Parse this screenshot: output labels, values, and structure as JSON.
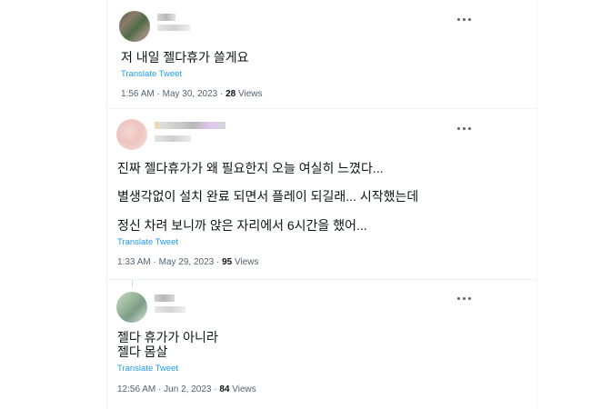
{
  "tweets": [
    {
      "text_lines": [
        "저 내일 젤다휴가 쓸게요"
      ],
      "translate_label": "Translate Tweet",
      "time": "1:56 AM",
      "date": "May 30, 2023",
      "views_count": "28",
      "views_label": "Views"
    },
    {
      "text_lines": [
        "진짜 젤다휴가가 왜 필요한지 오늘 여실히 느꼈다...",
        "별생각없이 설치 완료 되면서 플레이 되길래... 시작했는데",
        "정신 차려 보니까 앉은 자리에서 6시간을 했어..."
      ],
      "translate_label": "Translate Tweet",
      "time": "1:33 AM",
      "date": "May 29, 2023",
      "views_count": "95",
      "views_label": "Views"
    },
    {
      "text_lines": [
        "젤다 휴가가 아니라",
        "젤다 몸살"
      ],
      "translate_label": "Translate Tweet",
      "time": "12:56 AM",
      "date": "Jun 2, 2023",
      "views_count": "84",
      "views_label": "Views"
    }
  ],
  "separator": "·",
  "colors": {
    "link": "#1d9bf0",
    "secondary_text": "#536471",
    "primary_text": "#0f1419",
    "divider": "#eff3f4"
  },
  "icons": [
    "more-options-icon"
  ]
}
